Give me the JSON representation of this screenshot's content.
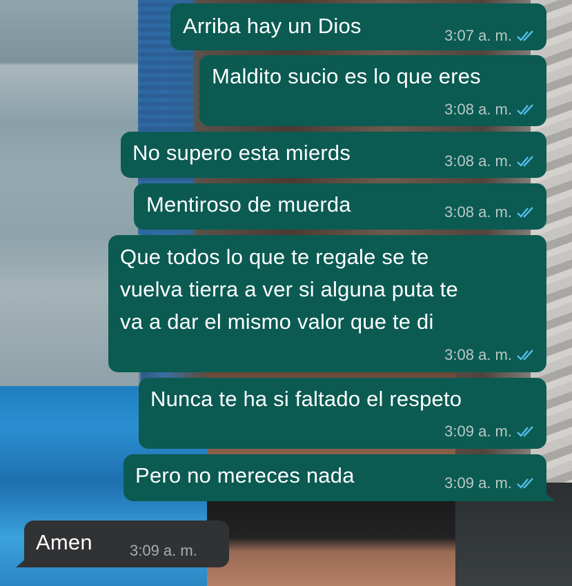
{
  "messages": [
    {
      "direction": "outgoing",
      "text": "Arriba hay un Dios",
      "time": "3:07 a. m.",
      "status": "read"
    },
    {
      "direction": "outgoing",
      "text": "Maldito sucio es lo que eres",
      "time": "3:08 a. m.",
      "status": "read"
    },
    {
      "direction": "outgoing",
      "text": "No supero esta mierds",
      "time": "3:08 a. m.",
      "status": "read"
    },
    {
      "direction": "outgoing",
      "text": "Mentiroso de muerda",
      "time": "3:08 a. m.",
      "status": "read"
    },
    {
      "direction": "outgoing",
      "lines": [
        "Que todos lo que te regale se te",
        "vuelva tierra a ver si alguna puta te",
        "va a dar el mismo valor que te di"
      ],
      "time": "3:08 a. m.",
      "status": "read"
    },
    {
      "direction": "outgoing",
      "text": "Nunca te ha si faltado el respeto",
      "time": "3:09 a. m.",
      "status": "read"
    },
    {
      "direction": "outgoing",
      "text": "Pero no mereces nada",
      "time": "3:09 a. m.",
      "status": "read"
    },
    {
      "direction": "incoming",
      "text": "Amen",
      "time": "3:09 a. m."
    }
  ],
  "colors": {
    "outgoing_bubble": "#0b5b52",
    "incoming_bubble": "#303234",
    "read_ticks": "#53bdeb"
  },
  "icons": {
    "read_status": "double-check-icon"
  }
}
